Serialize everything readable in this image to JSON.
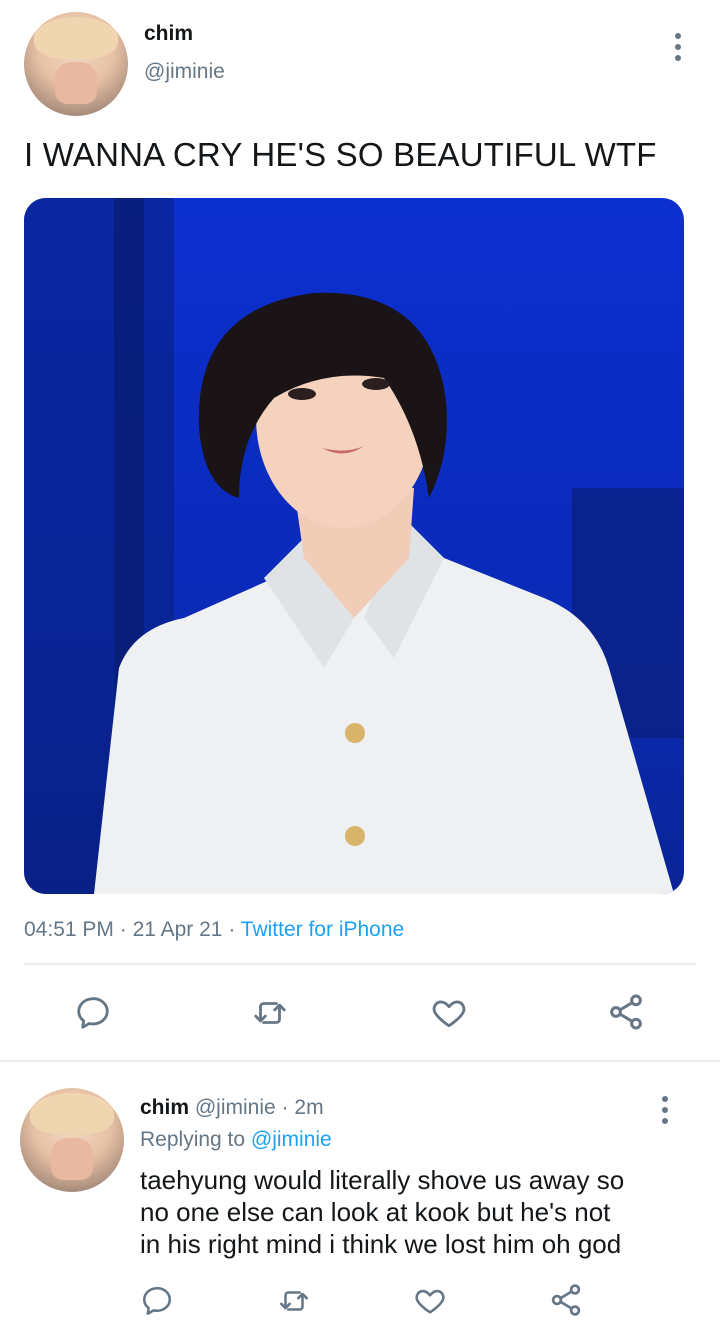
{
  "tweet": {
    "author_name": "chim",
    "author_handle": "@jiminie",
    "text": "I WANNA CRY HE'S SO BEAUTIFUL WTF",
    "time": "04:51 PM",
    "date": "21 Apr 21",
    "source": "Twitter for iPhone",
    "sep": "·"
  },
  "reply": {
    "author_name": "chim",
    "author_handle": "@jiminie",
    "time_ago": "2m",
    "replying_to_label": "Replying to",
    "replying_to_handle": "@jiminie",
    "text_lines": [
      "taehyung would literally shove us away so",
      "no one else can look at kook but he's not",
      "in his right mind i think we lost him oh god"
    ]
  },
  "icons": {
    "reply": "comment-icon",
    "retweet": "retweet-icon",
    "like": "heart-icon",
    "share": "share-icon",
    "more": "more-vertical-icon"
  },
  "colors": {
    "muted": "#657786",
    "link": "#1da1f2",
    "divider": "#e6ecf0",
    "image_blue": "#0c2fd0"
  }
}
